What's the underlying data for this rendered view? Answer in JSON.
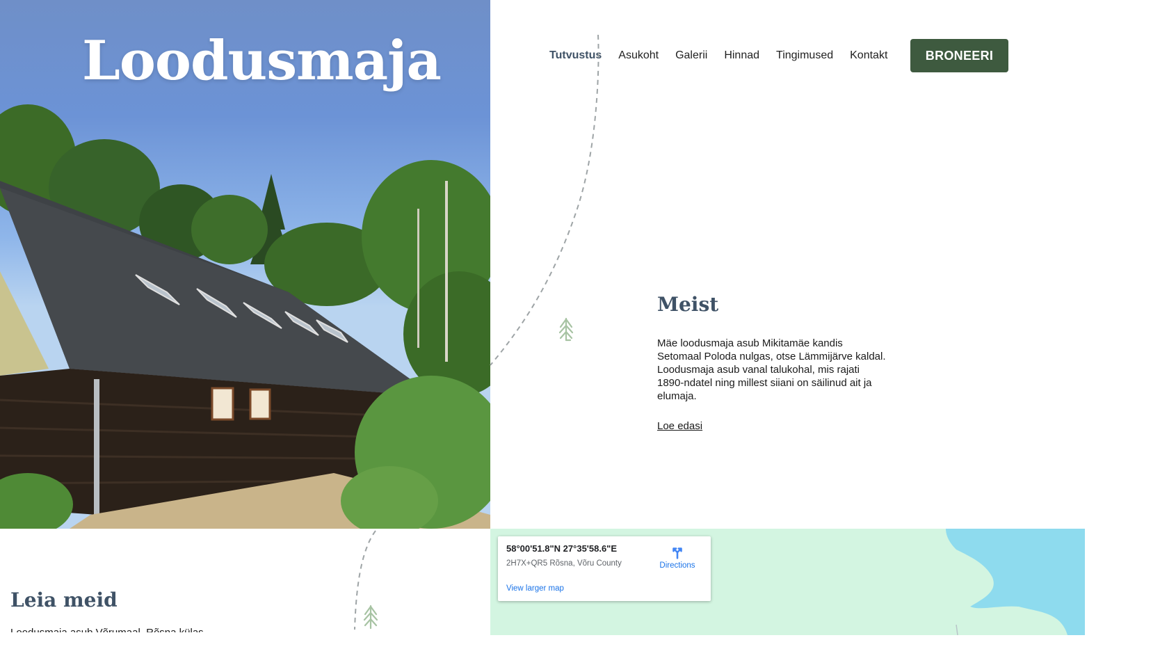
{
  "header": {
    "site_title": "Loodusmaja",
    "nav": [
      {
        "label": "Tutvustus",
        "active": true
      },
      {
        "label": "Asukoht",
        "active": false
      },
      {
        "label": "Galerii",
        "active": false
      },
      {
        "label": "Hinnad",
        "active": false
      },
      {
        "label": "Tingimused",
        "active": false
      },
      {
        "label": "Kontakt",
        "active": false
      }
    ],
    "book_label": "BRONEERI"
  },
  "about": {
    "title": "Meist",
    "text": "Mäe loodusmaja asub Mikitamäe kandis Setomaal Poloda nulgas, otse Lämmijärve kaldal. Loodusmaja asub vanal talukohal, mis rajati 1890-ndatel ning millest siiani on säilinud ait ja elumaja.",
    "read_more": "Loe edasi"
  },
  "find_us": {
    "title": "Leia meid",
    "text": "Loodusmaja asub Võrumaal, Rõsna külas"
  },
  "map": {
    "coords": "58°00'51.8\"N 27°35'58.6\"E",
    "plus_code": "2H7X+QR5 Rõsna, Võru County",
    "directions_label": "Directions",
    "larger_map_label": "View larger map"
  },
  "colors": {
    "accent": "#3e5a3f",
    "heading": "#3f5266",
    "map_land": "#d3f5e1",
    "map_water": "#8edbee",
    "tree_icon": "#a7c3a3",
    "link_blue": "#1a73e8"
  }
}
